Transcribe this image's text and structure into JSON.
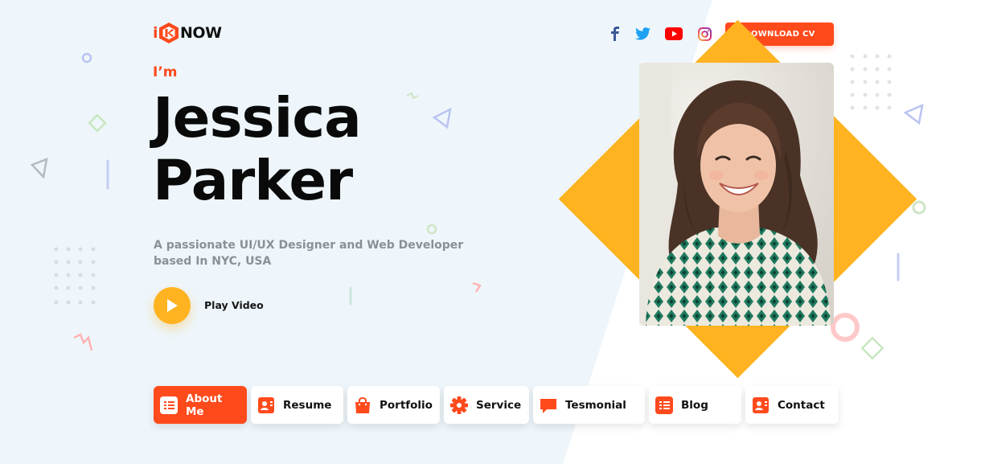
{
  "header": {
    "logo_i": "i",
    "logo_rest": "NOW",
    "download_cv": "DOWNLOAD CV",
    "social": [
      "facebook-icon",
      "twitter-icon",
      "youtube-icon",
      "instagram-icon"
    ]
  },
  "hero": {
    "greeting": "I’m",
    "first_name": "Jessica",
    "last_name": "Parker",
    "tagline_line1": "A passionate UI/UX Designer and Web Developer",
    "tagline_line2": "based In NYC, USA",
    "play_label": "Play Video"
  },
  "nav": {
    "items": [
      {
        "label": "About Me",
        "icon": "list-icon",
        "active": true
      },
      {
        "label": "Resume",
        "icon": "contact-card-icon",
        "active": false
      },
      {
        "label": "Portfolio",
        "icon": "shopping-bag-icon",
        "active": false
      },
      {
        "label": "Service",
        "icon": "gear-icon",
        "active": false
      },
      {
        "label": "Tesmonial",
        "icon": "chat-bubble-icon",
        "active": false
      },
      {
        "label": "Blog",
        "icon": "list-icon",
        "active": false
      },
      {
        "label": "Contact",
        "icon": "contact-card-icon",
        "active": false
      }
    ]
  },
  "colors": {
    "accent": "#ff4a1c",
    "yellow": "#ffb320",
    "background": "#eef6fb"
  }
}
